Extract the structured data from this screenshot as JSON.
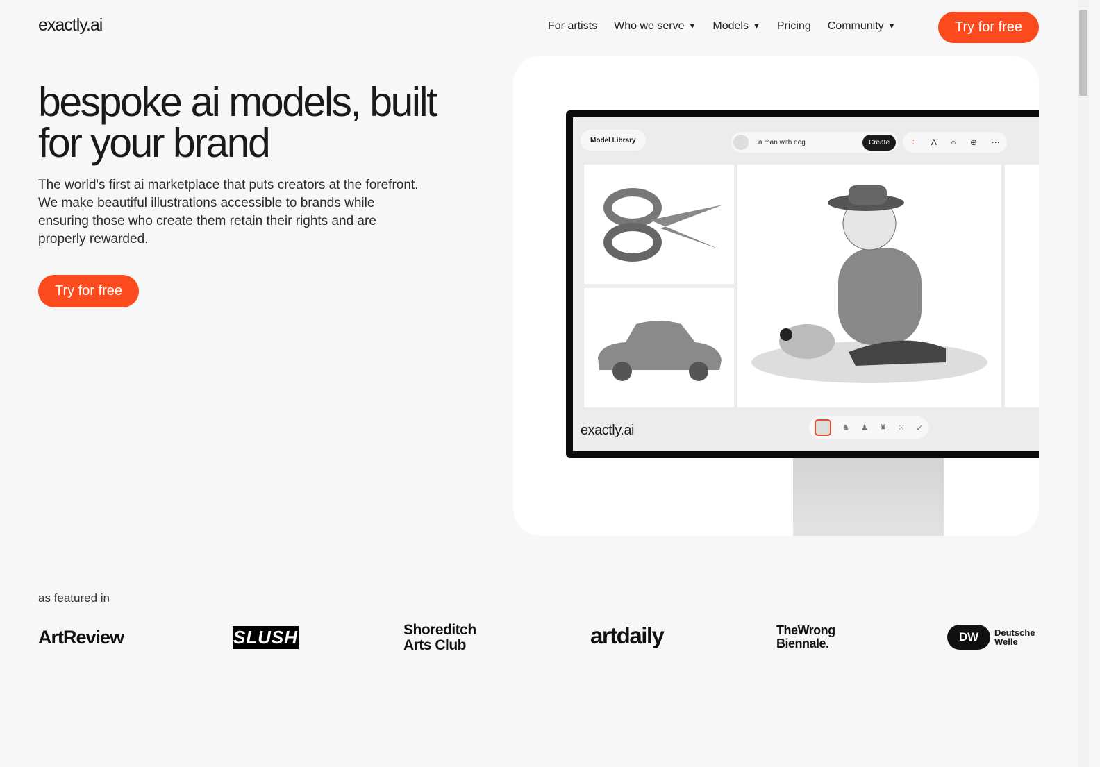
{
  "header": {
    "logo": "exactly.ai",
    "nav": [
      {
        "label": "For artists",
        "dropdown": false
      },
      {
        "label": "Who we serve",
        "dropdown": true
      },
      {
        "label": "Models",
        "dropdown": true
      },
      {
        "label": "Pricing",
        "dropdown": false
      },
      {
        "label": "Community",
        "dropdown": true
      }
    ],
    "cta": "Try for free"
  },
  "hero": {
    "title": "bespoke ai models, built for your brand",
    "description": "The world's first ai marketplace that puts creators at the forefront. We make beautiful illustrations accessible to brands while ensuring those who create them retain their rights and are properly rewarded.",
    "cta": "Try for free"
  },
  "mockup": {
    "model_library": "Model Library",
    "prompt": "a man with dog",
    "create": "Create",
    "logo": "exactly.ai",
    "tools": [
      "palette-icon",
      "pen-icon",
      "lasso-icon",
      "download-icon",
      "more-icon"
    ]
  },
  "featured": {
    "label": "as featured in",
    "brands": [
      "ArtReview",
      "SLUSH",
      "Shoreditch Arts Club",
      "artdaily",
      "TheWrong Biennale.",
      "Deutsche Welle"
    ]
  },
  "colors": {
    "accent": "#fb4a1d",
    "background": "#f7f7f7"
  }
}
